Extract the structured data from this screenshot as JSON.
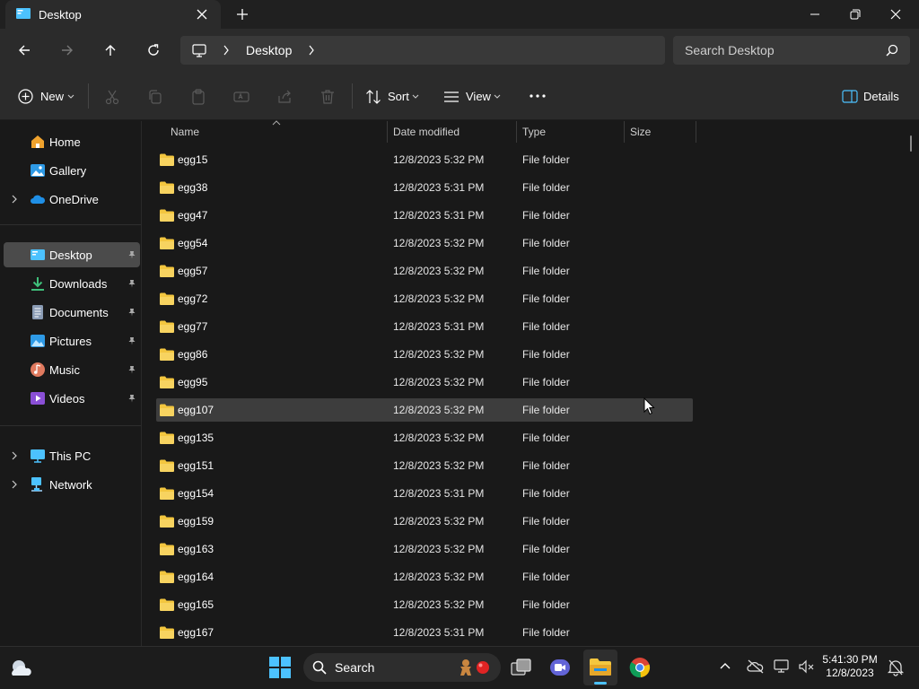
{
  "window": {
    "tab_title": "Desktop"
  },
  "address": {
    "crumb": "Desktop",
    "search_placeholder": "Search Desktop"
  },
  "toolbar": {
    "new_label": "New",
    "sort_label": "Sort",
    "view_label": "View",
    "details_label": "Details"
  },
  "sidebar": {
    "items": [
      {
        "label": "Home",
        "icon": "home-icon"
      },
      {
        "label": "Gallery",
        "icon": "gallery-icon"
      },
      {
        "label": "OneDrive",
        "icon": "onedrive-icon"
      },
      {
        "label": "Desktop",
        "icon": "desktop-icon"
      },
      {
        "label": "Downloads",
        "icon": "downloads-icon"
      },
      {
        "label": "Documents",
        "icon": "documents-icon"
      },
      {
        "label": "Pictures",
        "icon": "pictures-icon"
      },
      {
        "label": "Music",
        "icon": "music-icon"
      },
      {
        "label": "Videos",
        "icon": "videos-icon"
      },
      {
        "label": "This PC",
        "icon": "this-pc-icon"
      },
      {
        "label": "Network",
        "icon": "network-icon"
      }
    ]
  },
  "columns": {
    "name": "Name",
    "date": "Date modified",
    "type": "Type",
    "size": "Size"
  },
  "files": [
    {
      "name": "egg15",
      "date": "12/8/2023 5:32 PM",
      "type": "File folder"
    },
    {
      "name": "egg38",
      "date": "12/8/2023 5:31 PM",
      "type": "File folder"
    },
    {
      "name": "egg47",
      "date": "12/8/2023 5:31 PM",
      "type": "File folder"
    },
    {
      "name": "egg54",
      "date": "12/8/2023 5:32 PM",
      "type": "File folder"
    },
    {
      "name": "egg57",
      "date": "12/8/2023 5:32 PM",
      "type": "File folder"
    },
    {
      "name": "egg72",
      "date": "12/8/2023 5:32 PM",
      "type": "File folder"
    },
    {
      "name": "egg77",
      "date": "12/8/2023 5:31 PM",
      "type": "File folder"
    },
    {
      "name": "egg86",
      "date": "12/8/2023 5:32 PM",
      "type": "File folder"
    },
    {
      "name": "egg95",
      "date": "12/8/2023 5:32 PM",
      "type": "File folder"
    },
    {
      "name": "egg107",
      "date": "12/8/2023 5:32 PM",
      "type": "File folder"
    },
    {
      "name": "egg135",
      "date": "12/8/2023 5:32 PM",
      "type": "File folder"
    },
    {
      "name": "egg151",
      "date": "12/8/2023 5:32 PM",
      "type": "File folder"
    },
    {
      "name": "egg154",
      "date": "12/8/2023 5:31 PM",
      "type": "File folder"
    },
    {
      "name": "egg159",
      "date": "12/8/2023 5:32 PM",
      "type": "File folder"
    },
    {
      "name": "egg163",
      "date": "12/8/2023 5:32 PM",
      "type": "File folder"
    },
    {
      "name": "egg164",
      "date": "12/8/2023 5:32 PM",
      "type": "File folder"
    },
    {
      "name": "egg165",
      "date": "12/8/2023 5:32 PM",
      "type": "File folder"
    },
    {
      "name": "egg167",
      "date": "12/8/2023 5:31 PM",
      "type": "File folder"
    }
  ],
  "taskbar": {
    "search_label": "Search",
    "time": "5:41:30 PM",
    "date": "12/8/2023"
  },
  "colors": {
    "folder": "#f3c63f",
    "accent": "#4cc2ff"
  }
}
